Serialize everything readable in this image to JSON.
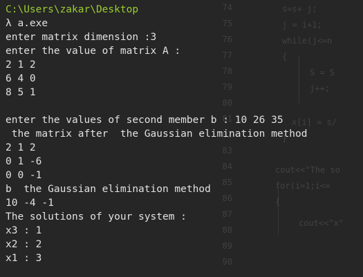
{
  "prompt": {
    "path": "C:\\Users\\zakar\\Desktop",
    "command": "λ a.exe"
  },
  "output_lines": [
    "enter matrix dimension :3",
    "enter the value of matrix A :",
    "2 1 2",
    "6 4 0",
    "8 5 1",
    "",
    "enter the values of second member b : 10 26 35",
    " the matrix after  the Gaussian elimination method",
    "2 1 2",
    "0 1 -6",
    "0 0 -1",
    "b  the Gaussian elimination method",
    "10 -4 -1",
    "The solutions of your system :",
    "x3 : 1",
    "x2 : 2",
    "x1 : 3"
  ],
  "background_editor": {
    "line_numbers": [
      "74",
      "75",
      "76",
      "77",
      "78",
      "79",
      "80",
      "81",
      "82",
      "83",
      "84",
      "85",
      "86",
      "87",
      "88",
      "89",
      "90"
    ],
    "code_fragments": [
      "s=s+ j;",
      "j = i+1;",
      "while(j<=n",
      "{",
      "S = S",
      "j++;",
      "x[i] = s/",
      "}",
      "cout<<\"The so",
      "for(i=1;i<=",
      "{",
      "cout<<\"x\""
    ]
  },
  "colors": {
    "background": "#262626",
    "text": "#e2e2e2",
    "prompt_path": "#9acd32"
  }
}
